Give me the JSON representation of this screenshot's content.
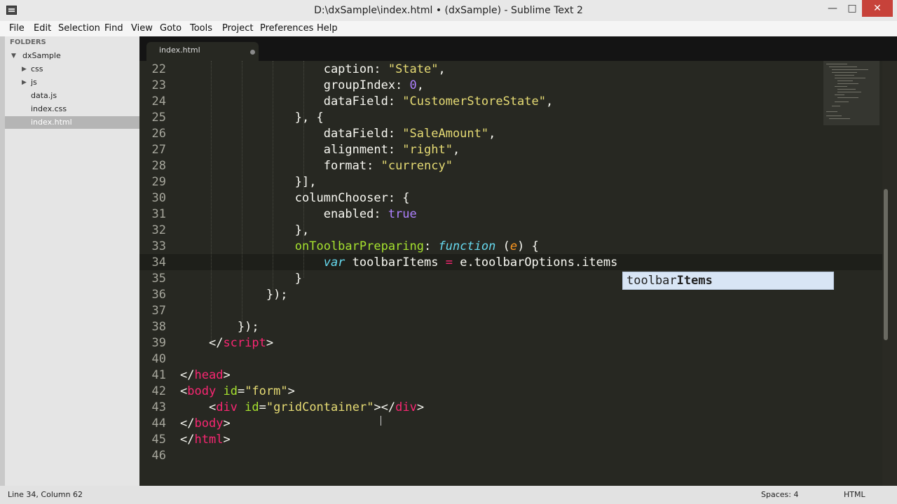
{
  "window": {
    "title": "D:\\dxSample\\index.html • (dxSample) - Sublime Text 2",
    "min": "—",
    "max": "□",
    "close": "✕"
  },
  "menu": [
    "File",
    "Edit",
    "Selection",
    "Find",
    "View",
    "Goto",
    "Tools",
    "Project",
    "Preferences",
    "Help"
  ],
  "sidebar": {
    "heading": "FOLDERS",
    "items": [
      {
        "label": "dxSample",
        "arrow": "▼",
        "selected": false
      },
      {
        "label": "css",
        "arrow": "▶",
        "selected": false
      },
      {
        "label": "js",
        "arrow": "▶",
        "selected": false
      },
      {
        "label": "data.js",
        "arrow": "",
        "selected": false
      },
      {
        "label": "index.css",
        "arrow": "",
        "selected": false
      },
      {
        "label": "index.html",
        "arrow": "",
        "selected": true
      }
    ]
  },
  "tab": {
    "label": "index.html"
  },
  "editor": {
    "line_numbers": [
      "22",
      "23",
      "24",
      "25",
      "26",
      "27",
      "28",
      "29",
      "30",
      "31",
      "32",
      "33",
      "34",
      "35",
      "36",
      "37",
      "38",
      "39",
      "40",
      "41",
      "42",
      "43",
      "44",
      "45",
      "46"
    ],
    "current_line": "34"
  },
  "autocomplete": {
    "prefix": "toolbar",
    "match": "Items"
  },
  "status": {
    "position": "Line 34, Column 62",
    "spaces": "Spaces: 4",
    "syntax": "HTML"
  }
}
